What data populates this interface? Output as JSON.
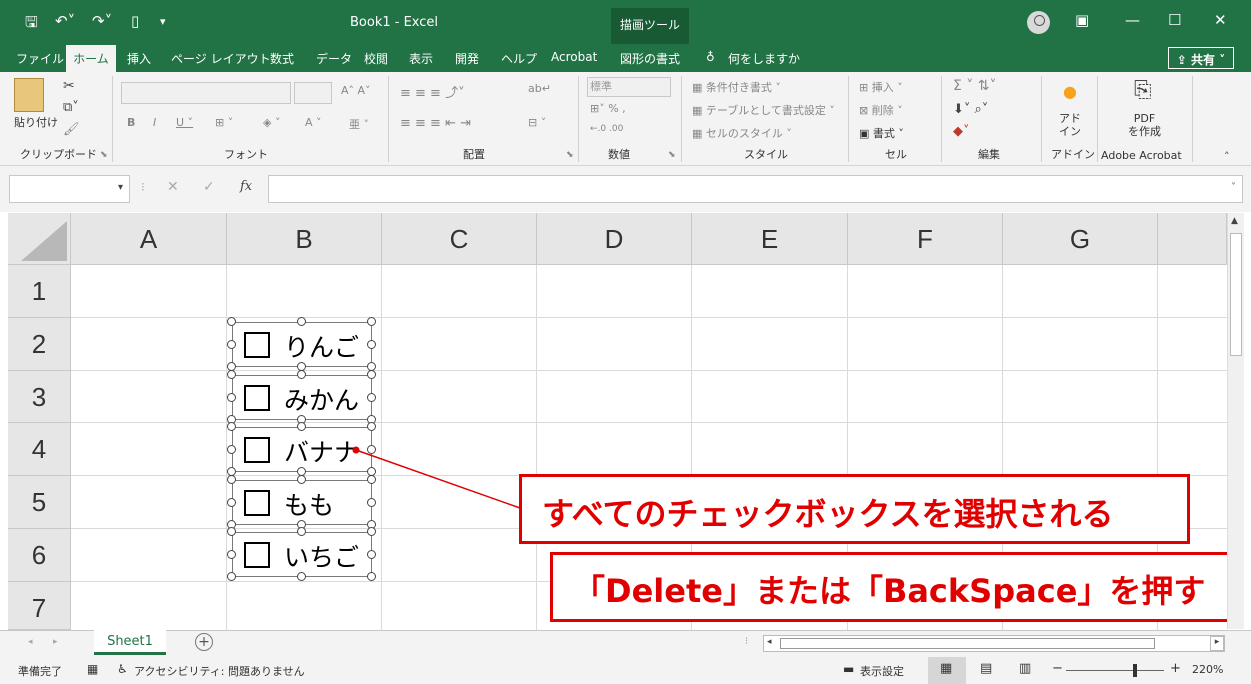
{
  "titlebar": {
    "doc_title": "Book1  -  Excel",
    "context_tool": "描画ツール",
    "share": "共有"
  },
  "menu": {
    "items": [
      "ファイル",
      "ホーム",
      "挿入",
      "ページ レイアウト",
      "数式",
      "データ",
      "校閲",
      "表示",
      "開発",
      "ヘルプ",
      "Acrobat",
      "図形の書式",
      "何をしますか"
    ]
  },
  "ribbon": {
    "groups": [
      "クリップボード",
      "フォント",
      "配置",
      "数値",
      "スタイル",
      "セル",
      "編集",
      "アドイン",
      "Adobe Acrobat"
    ],
    "paste": "貼り付け",
    "number_format": "標準",
    "style_items": [
      "条件付き書式",
      "テーブルとして書式設定",
      "セルのスタイル"
    ],
    "cell_items": [
      "挿入",
      "削除",
      "書式"
    ],
    "addin": "アド\nイン",
    "pdf": "PDF\nを作成"
  },
  "formula_bar": {
    "fx": "fx"
  },
  "grid": {
    "columns": [
      "A",
      "B",
      "C",
      "D",
      "E",
      "F",
      "G"
    ],
    "rows": [
      "1",
      "2",
      "3",
      "4",
      "5",
      "6",
      "7"
    ]
  },
  "checkboxes": [
    "りんご",
    "みかん",
    "バナナ",
    "もも",
    "いちご"
  ],
  "callouts": {
    "select": "すべてのチェックボックスを選択される",
    "delete": "「Delete」または「BackSpace」を押す"
  },
  "sheet": {
    "tab": "Sheet1",
    "add": "+"
  },
  "status": {
    "ready": "準備完了",
    "accessibility": "アクセシビリティ: 問題ありません",
    "display_settings": "表示設定",
    "zoom": "220%"
  },
  "colors": {
    "excel_green": "#217346",
    "callout_red": "#e00000"
  }
}
